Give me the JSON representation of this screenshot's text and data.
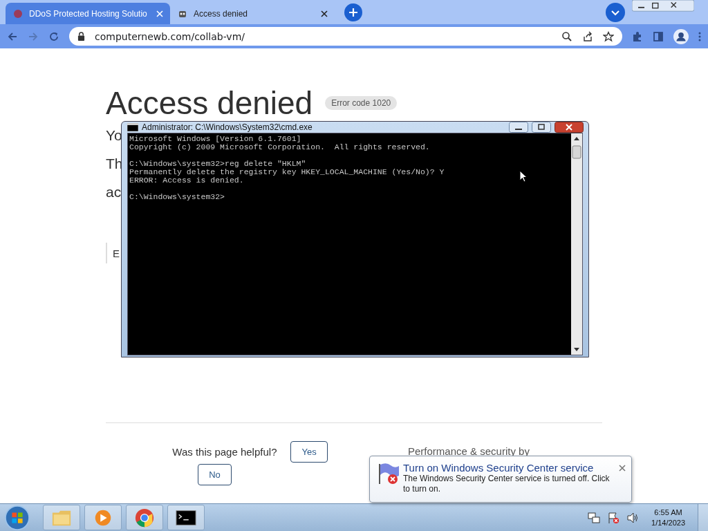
{
  "browser": {
    "tabs": [
      {
        "title": "DDoS Protected Hosting Solutio",
        "selected": true
      },
      {
        "title": "Access denied",
        "selected": false
      }
    ],
    "address": "computernewb.com/collab-vm/"
  },
  "page": {
    "heading": "Access denied",
    "error_code": "Error code 1020",
    "partial_lines": [
      "Yo",
      "Th",
      "ac"
    ],
    "partial_note": "E",
    "helpful_question": "Was this page helpful?",
    "buttons": [
      "Yes",
      "No"
    ],
    "footer": "Performance & security by"
  },
  "cmd_window": {
    "title": "Administrator: C:\\Windows\\System32\\cmd.exe",
    "blocks": [
      [
        "Microsoft Windows [Version 6.1.7601]",
        "Copyright (c) 2009 Microsoft Corporation.  All rights reserved."
      ],
      [
        "C:\\Windows\\system32>reg delete \"HKLM\"",
        "Permanently delete the registry key HKEY_LOCAL_MACHINE (Yes/No)? Y",
        "ERROR: Access is denied."
      ],
      [
        "C:\\Windows\\system32>"
      ]
    ]
  },
  "notification": {
    "title": "Turn on Windows Security Center service",
    "body": "The Windows Security Center service is turned off. Click to turn on."
  },
  "taskbar": {
    "apps": [
      {
        "kind": "explorer"
      },
      {
        "kind": "media"
      },
      {
        "kind": "chrome"
      },
      {
        "kind": "cmd"
      }
    ],
    "time": "6:55 AM",
    "date": "1/14/2023"
  }
}
